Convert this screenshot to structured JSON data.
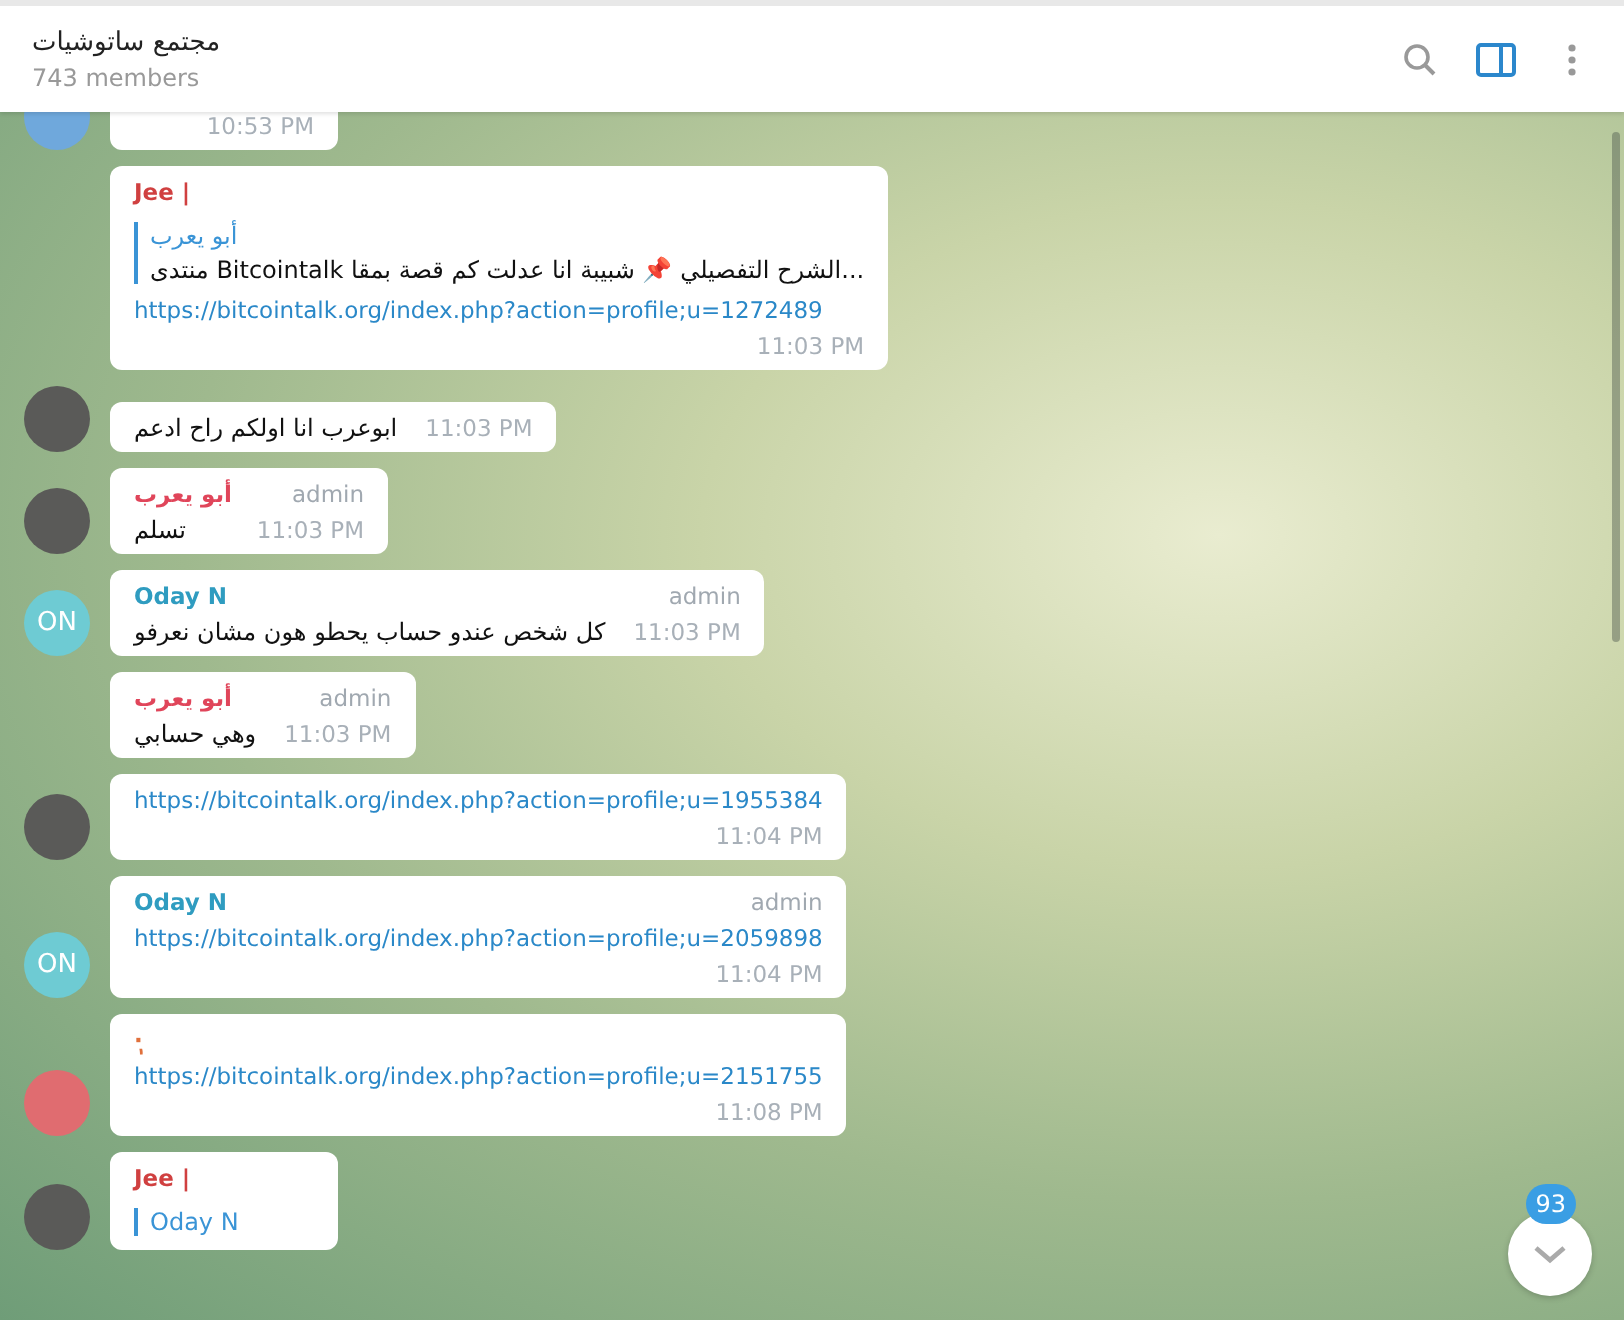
{
  "header": {
    "title": "مجتمع ساتوشيات",
    "subtitle": "743 members",
    "sidebar_toggle_on": true
  },
  "messages": [
    {
      "avatar": {
        "kind": "plain",
        "color": "#6fa8dc"
      },
      "time": "10:53 PM",
      "cut_top": true
    },
    {
      "avatar": {
        "kind": "none"
      },
      "sender": {
        "name": "Jee |",
        "color": "#d04040"
      },
      "reply": {
        "author": "أبو يعرب",
        "text": "...الشرح التفصيلي 📌 شبيبة انا عدلت كم قصة بمقا  Bitcointalk منتدى"
      },
      "link": "https://bitcointalk.org/index.php?action=profile;u=1272489",
      "time": "11:03 PM"
    },
    {
      "avatar": {
        "kind": "photo"
      },
      "text": "ابوعرب انا اولكم راح ادعم",
      "time": "11:03 PM"
    },
    {
      "avatar": {
        "kind": "photo"
      },
      "sender": {
        "name": "أبو يعرب",
        "color": "#e0455a"
      },
      "badge": "admin",
      "text": "تسلم",
      "time": "11:03 PM"
    },
    {
      "avatar": {
        "kind": "initials",
        "text": "ON",
        "color": "#6ecbd3"
      },
      "sender": {
        "name": "Oday N",
        "color": "#2f9cc0"
      },
      "badge": "admin",
      "text": "كل شخص عندو حساب يحطو هون مشان نعرفو",
      "time": "11:03 PM"
    },
    {
      "avatar": {
        "kind": "none"
      },
      "sender": {
        "name": "أبو يعرب",
        "color": "#e0455a"
      },
      "badge": "admin",
      "text": "وهي حسابي",
      "time": "11:03 PM"
    },
    {
      "avatar": {
        "kind": "photo"
      },
      "link": "https://bitcointalk.org/index.php?action=profile;u=1955384",
      "time": "11:04 PM"
    },
    {
      "avatar": {
        "kind": "initials",
        "text": "ON",
        "color": "#6ecbd3"
      },
      "sender": {
        "name": "Oday N",
        "color": "#2f9cc0"
      },
      "badge": "admin",
      "link": "https://bitcointalk.org/index.php?action=profile;u=2059898",
      "time": "11:04 PM"
    },
    {
      "avatar": {
        "kind": "plain",
        "color": "#e06c70"
      },
      "sender": {
        "name": "ٖ·",
        "color": "#e0703c"
      },
      "link": "https://bitcointalk.org/index.php?action=profile;u=2151755",
      "time": "11:08 PM"
    },
    {
      "avatar": {
        "kind": "photo"
      },
      "sender": {
        "name": "Jee |",
        "color": "#d04040"
      },
      "reply": {
        "author": "Oday N"
      }
    }
  ],
  "scroll_button": {
    "badge": "93"
  }
}
